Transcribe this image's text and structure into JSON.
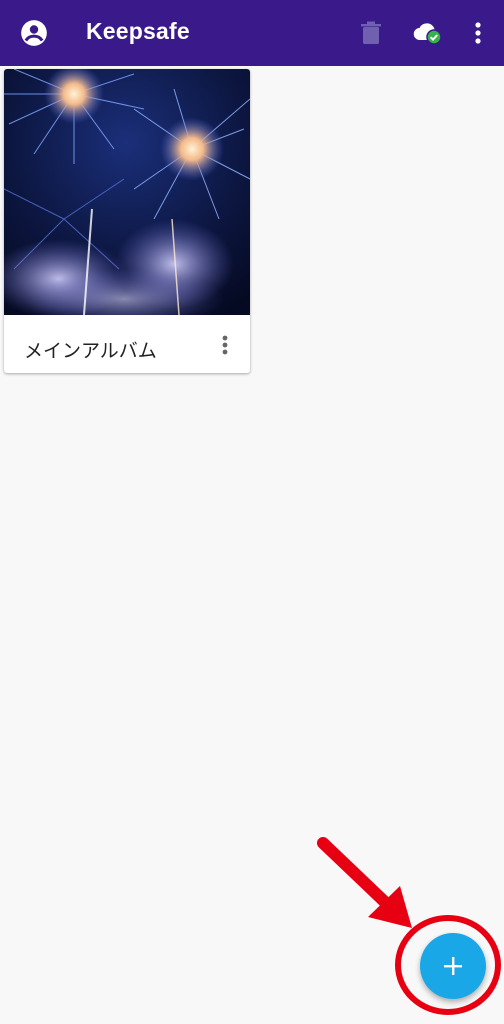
{
  "appbar": {
    "title": "Keepsafe",
    "icons": [
      "account-icon",
      "trash-icon",
      "cloud-sync-check-icon",
      "more-vert-icon"
    ]
  },
  "albums": [
    {
      "label": "メインアルバム",
      "thumbnail": "fireworks-photo"
    }
  ],
  "fab": {
    "icon": "plus-icon",
    "label": "+"
  },
  "annotation": {
    "arrow_color": "#e60012",
    "circle_color": "#e60012"
  },
  "colors": {
    "appbar": "#3a1a8a",
    "fab": "#1aa7e8",
    "background": "#f8f8f8"
  }
}
